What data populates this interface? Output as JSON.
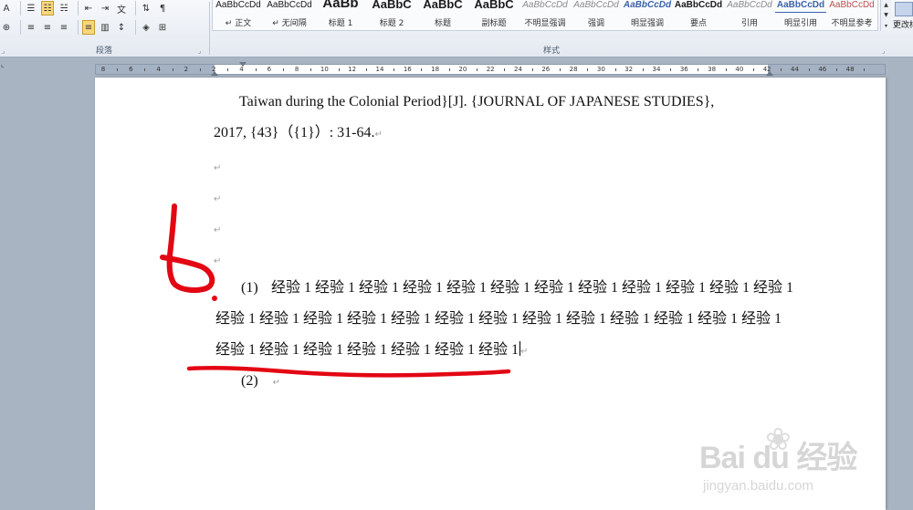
{
  "ribbon": {
    "paragraph_group": {
      "label": "段落",
      "row1": [
        {
          "name": "font-color-a-icon",
          "glyph": "A"
        },
        {
          "name": "bullets-icon",
          "glyph": "☰"
        },
        {
          "name": "numbering-icon",
          "glyph": "☷",
          "active": true
        },
        {
          "name": "multilevel-list-icon",
          "glyph": "☵"
        },
        {
          "name": "decrease-indent-icon",
          "glyph": "⇤"
        },
        {
          "name": "increase-indent-icon",
          "glyph": "⇥"
        },
        {
          "name": "chinese-layout-icon",
          "glyph": "文"
        },
        {
          "name": "sort-icon",
          "glyph": "⇅"
        },
        {
          "name": "show-marks-icon",
          "glyph": "¶"
        }
      ],
      "row2": [
        {
          "name": "phonetic-guide-icon",
          "glyph": "⊕"
        },
        {
          "name": "align-left-icon",
          "glyph": "≡"
        },
        {
          "name": "align-center-icon",
          "glyph": "≡"
        },
        {
          "name": "align-right-icon",
          "glyph": "≡"
        },
        {
          "name": "justify-icon",
          "glyph": "≡",
          "active": true
        },
        {
          "name": "distributed-icon",
          "glyph": "▥"
        },
        {
          "name": "line-spacing-icon",
          "glyph": "↕"
        },
        {
          "name": "shading-icon",
          "glyph": "◈"
        },
        {
          "name": "borders-icon",
          "glyph": "⊞"
        }
      ]
    },
    "styles_group": {
      "label": "样式",
      "items": [
        {
          "preview": "AaBbCcDd",
          "name": "↵ 正文",
          "variant": ""
        },
        {
          "preview": "AaBbCcDd",
          "name": "↵ 无间隔",
          "variant": ""
        },
        {
          "preview": "AaBb",
          "name": "标题 1",
          "variant": "big"
        },
        {
          "preview": "AaBbC",
          "name": "标题 2",
          "variant": "med"
        },
        {
          "preview": "AaBbC",
          "name": "标题",
          "variant": "med"
        },
        {
          "preview": "AaBbC",
          "name": "副标题",
          "variant": "med"
        },
        {
          "preview": "AaBbCcDd",
          "name": "不明显强调",
          "variant": "ital"
        },
        {
          "preview": "AaBbCcDd",
          "name": "强调",
          "variant": "ital"
        },
        {
          "preview": "AaBbCcDd",
          "name": "明显强调",
          "variant": "blue"
        },
        {
          "preview": "AaBbCcDd",
          "name": "要点",
          "variant": "boldblk"
        },
        {
          "preview": "AaBbCcDd",
          "name": "引用",
          "variant": "ital"
        },
        {
          "preview": "AaBbCcDd",
          "name": "明显引用",
          "variant": "underl"
        },
        {
          "preview": "AaBbCcDd",
          "name": "不明显参考",
          "variant": "red"
        }
      ]
    },
    "change_styles_label": "更改样式"
  },
  "ruler": {
    "numbers": [
      "8",
      "6",
      "4",
      "2",
      "2",
      "4",
      "6",
      "8",
      "10",
      "12",
      "14",
      "16",
      "18",
      "20",
      "22",
      "24",
      "26",
      "28",
      "30",
      "32",
      "34",
      "36",
      "38",
      "40",
      "42",
      "44",
      "46",
      "48"
    ]
  },
  "document": {
    "ref_line_1": "Taiwan during the Colonial Period}[J]. {JOURNAL OF JAPANESE STUDIES},",
    "ref_line_2": "2017, {43}（{1}）: 31-64.",
    "paragraph_mark": "↵",
    "item1_number": "(1)",
    "item1_line1": "经验 1 经验 1 经验 1 经验 1 经验 1 经验 1 经验 1 经验 1 经验 1 经验 1 经验 1 经验 1",
    "item1_line2": "经验 1 经验 1 经验 1 经验 1 经验 1 经验 1 经验 1 经验 1 经验 1 经验 1 经验 1 经验 1 经验 1",
    "item1_line3": "经验 1 经验 1 经验 1 经验 1 经验 1 经验 1 经验 1",
    "item2_number": "(2)"
  },
  "annotation": {
    "color": "#e30613",
    "handwritten_text": "6."
  },
  "watermark": {
    "brand": "Bai du 经验",
    "url": "jingyan.baidu.com"
  }
}
